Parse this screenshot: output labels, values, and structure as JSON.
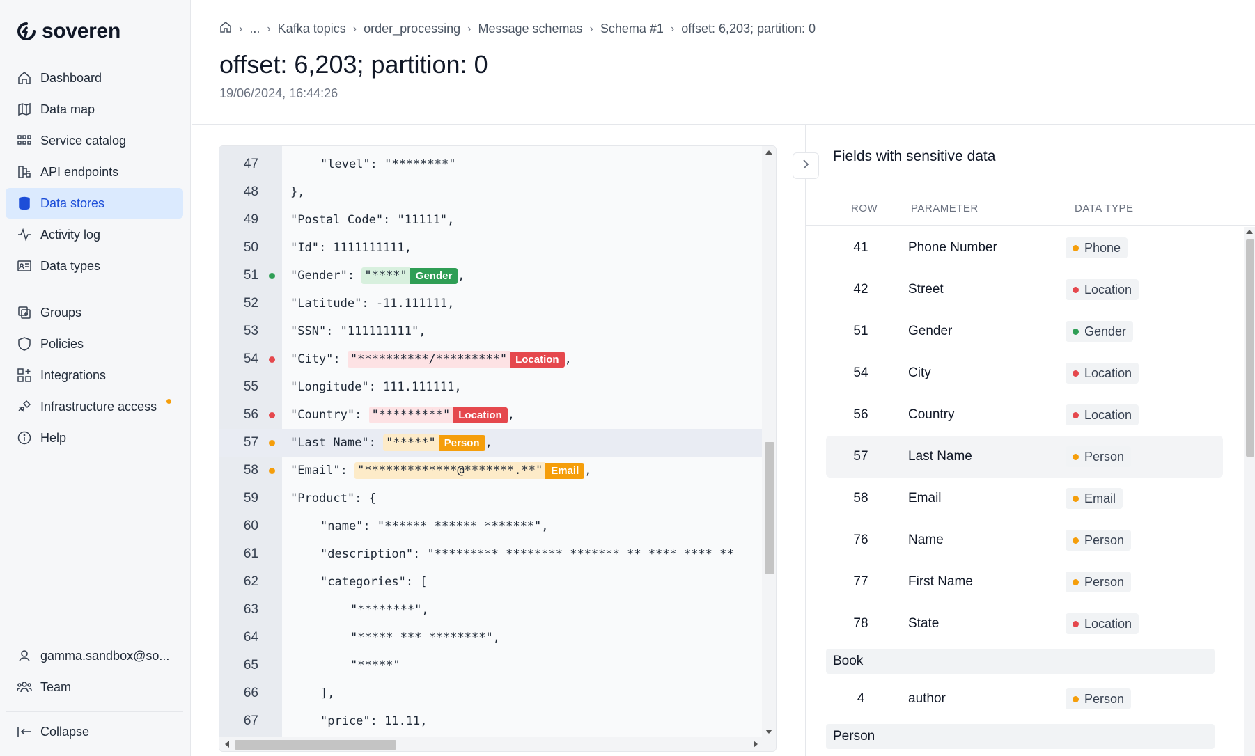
{
  "brand": {
    "name": "soveren"
  },
  "sidebar": {
    "items": [
      {
        "label": "Dashboard",
        "icon": "home-icon"
      },
      {
        "label": "Data map",
        "icon": "map-icon"
      },
      {
        "label": "Service catalog",
        "icon": "grid-icon"
      },
      {
        "label": "API endpoints",
        "icon": "api-icon"
      },
      {
        "label": "Data stores",
        "icon": "database-icon",
        "active": true
      },
      {
        "label": "Activity log",
        "icon": "activity-icon"
      },
      {
        "label": "Data types",
        "icon": "id-card-icon"
      }
    ],
    "items2": [
      {
        "label": "Groups",
        "icon": "groups-icon"
      },
      {
        "label": "Policies",
        "icon": "shield-icon"
      },
      {
        "label": "Integrations",
        "icon": "integrations-icon"
      },
      {
        "label": "Infrastructure access",
        "icon": "plug-icon"
      },
      {
        "label": "Help",
        "icon": "info-icon"
      }
    ],
    "user": "gamma.sandbox@so...",
    "team": "Team",
    "collapse": "Collapse"
  },
  "breadcrumb": [
    "...",
    "Kafka topics",
    "order_processing",
    "Message schemas",
    "Schema #1",
    "offset: 6,203; partition: 0"
  ],
  "page": {
    "title": "offset: 6,203; partition: 0",
    "timestamp": "19/06/2024, 16:44:26"
  },
  "code": {
    "lines": [
      {
        "n": "47",
        "indent": 2,
        "text": "\"level\": \"********\""
      },
      {
        "n": "48",
        "indent": 1,
        "text": "},"
      },
      {
        "n": "49",
        "indent": 1,
        "text": "\"Postal Code\": \"11111\","
      },
      {
        "n": "50",
        "indent": 1,
        "text": "\"Id\": 1111111111,"
      },
      {
        "n": "51",
        "indent": 1,
        "key": "\"Gender\": ",
        "value": "\"****\"",
        "tag": "Gender",
        "color": "green",
        "after": ","
      },
      {
        "n": "52",
        "indent": 1,
        "text": "\"Latitude\": -11.111111,"
      },
      {
        "n": "53",
        "indent": 1,
        "text": "\"SSN\": \"111111111\","
      },
      {
        "n": "54",
        "indent": 1,
        "key": "\"City\": ",
        "value": "\"**********/*********\"",
        "tag": "Location",
        "color": "red",
        "after": ","
      },
      {
        "n": "55",
        "indent": 1,
        "text": "\"Longitude\": 111.111111,"
      },
      {
        "n": "56",
        "indent": 1,
        "key": "\"Country\": ",
        "value": "\"*********\"",
        "tag": "Location",
        "color": "red",
        "after": ","
      },
      {
        "n": "57",
        "indent": 1,
        "key": "\"Last Name\": ",
        "value": "\"*****\"",
        "tag": "Person",
        "color": "orange",
        "after": ",",
        "highlight": true
      },
      {
        "n": "58",
        "indent": 1,
        "key": "\"Email\": ",
        "value": "\"*************@*******.**\"",
        "tag": "Email",
        "color": "orange",
        "after": ","
      },
      {
        "n": "59",
        "indent": 1,
        "text": "\"Product\": {"
      },
      {
        "n": "60",
        "indent": 2,
        "text": "\"name\": \"****** ****** *******\","
      },
      {
        "n": "61",
        "indent": 2,
        "text": "\"description\": \"********* ******** ******* ** **** **** **"
      },
      {
        "n": "62",
        "indent": 2,
        "text": "\"categories\": ["
      },
      {
        "n": "63",
        "indent": 3,
        "text": "\"********\","
      },
      {
        "n": "64",
        "indent": 3,
        "text": "\"***** *** ********\","
      },
      {
        "n": "65",
        "indent": 3,
        "text": "\"*****\""
      },
      {
        "n": "66",
        "indent": 2,
        "text": "],"
      },
      {
        "n": "67",
        "indent": 2,
        "text": "\"price\": 11.11,"
      }
    ]
  },
  "fields": {
    "title": "Fields with sensitive data",
    "columns": {
      "row": "ROW",
      "parameter": "PARAMETER",
      "data_type": "DATA TYPE"
    },
    "rows": [
      {
        "row": "41",
        "param": "Phone Number",
        "type": "Phone",
        "color": "orange"
      },
      {
        "row": "42",
        "param": "Street",
        "type": "Location",
        "color": "red"
      },
      {
        "row": "51",
        "param": "Gender",
        "type": "Gender",
        "color": "green"
      },
      {
        "row": "54",
        "param": "City",
        "type": "Location",
        "color": "red"
      },
      {
        "row": "56",
        "param": "Country",
        "type": "Location",
        "color": "red"
      },
      {
        "row": "57",
        "param": "Last Name",
        "type": "Person",
        "color": "orange",
        "selected": true
      },
      {
        "row": "58",
        "param": "Email",
        "type": "Email",
        "color": "orange"
      },
      {
        "row": "76",
        "param": "Name",
        "type": "Person",
        "color": "orange"
      },
      {
        "row": "77",
        "param": "First Name",
        "type": "Person",
        "color": "orange"
      },
      {
        "row": "78",
        "param": "State",
        "type": "Location",
        "color": "red"
      }
    ],
    "groups": [
      {
        "name": "Book",
        "rows": [
          {
            "row": "4",
            "param": "author",
            "type": "Person",
            "color": "orange"
          }
        ]
      },
      {
        "name": "Person",
        "rows": []
      }
    ]
  },
  "colors": {
    "green": "#2f9e55",
    "red": "#e5484d",
    "orange": "#f59e0b",
    "accent": "#1d4ed8"
  }
}
